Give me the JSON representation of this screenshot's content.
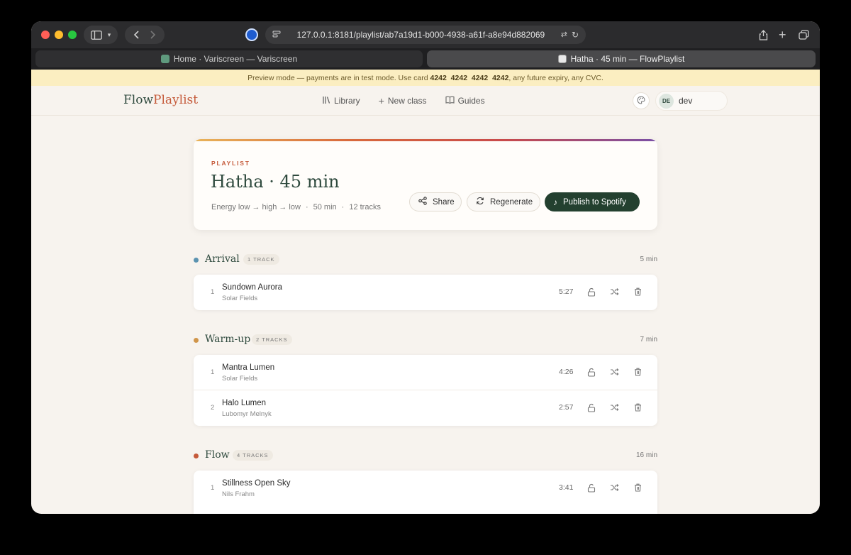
{
  "browser": {
    "url": "127.0.0.1:8181/playlist/ab7a19d1-b000-4938-a61f-a8e94d882069",
    "tabs": [
      {
        "label": "Home · Variscreen — Variscreen"
      },
      {
        "label": "Hatha · 45 min — FlowPlaylist"
      }
    ]
  },
  "banner": {
    "text_before": "Preview mode — payments are in test mode. Use card ",
    "card": "4242  4242  4242  4242",
    "text_after": ", any future expiry, any CVC."
  },
  "header": {
    "logo_part1": "Flow",
    "logo_part2": "Playlist",
    "nav": [
      {
        "label": "Library",
        "icon": "library-icon"
      },
      {
        "label": "New class",
        "icon": "plus-icon"
      },
      {
        "label": "Guides",
        "icon": "book-icon"
      }
    ],
    "user": {
      "initials": "DE",
      "name": "dev"
    }
  },
  "playlist": {
    "eyebrow": "PLAYLIST",
    "title": "Hatha · 45 min",
    "meta": [
      "Energy low → high → low",
      "·",
      "50 min",
      "·",
      "12 tracks"
    ],
    "buttons": {
      "share": "Share",
      "regenerate": "Regenerate",
      "publish": "Publish to Spotify"
    }
  },
  "sections": [
    {
      "title": "Arrival",
      "badge": "1 TRACK",
      "duration": "5 min",
      "color": "#5b93b0",
      "tracks": [
        {
          "num": "1",
          "title": "Sundown Aurora",
          "artist": "Solar Fields",
          "duration": "5:27"
        }
      ]
    },
    {
      "title": "Warm-up",
      "badge": "2 TRACKS",
      "duration": "7 min",
      "color": "#d0954a",
      "tracks": [
        {
          "num": "1",
          "title": "Mantra Lumen",
          "artist": "Solar Fields",
          "duration": "4:26"
        },
        {
          "num": "2",
          "title": "Halo Lumen",
          "artist": "Lubomyr Melnyk",
          "duration": "2:57"
        }
      ]
    },
    {
      "title": "Flow",
      "badge": "4 TRACKS",
      "duration": "16 min",
      "color": "#c55a3a",
      "tracks": [
        {
          "num": "1",
          "title": "Stillness Open Sky",
          "artist": "Nils Frahm",
          "duration": "3:41"
        }
      ]
    }
  ]
}
